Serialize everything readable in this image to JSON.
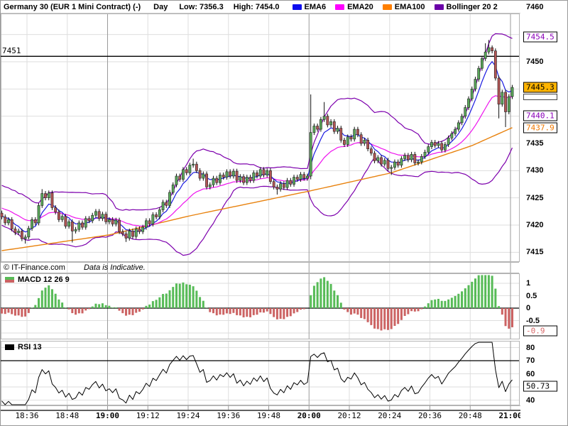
{
  "header": {
    "title": "Germany 30 (EUR 1 Mini Contract) (-)",
    "timeframe": "Day",
    "low_label": "Low: 7356.3",
    "high_label": "High: 7454.0",
    "legend": [
      {
        "name": "EMA6",
        "color": "#0d0dee"
      },
      {
        "name": "EMA20",
        "color": "#ff00ff"
      },
      {
        "name": "EMA100",
        "color": "#ff7f00"
      },
      {
        "name": "Bollinger 20 2",
        "color": "#6a00a8"
      }
    ]
  },
  "watermark": {
    "copyright": "© IT-Finance.com",
    "note": "Data is Indicative."
  },
  "price_axis": {
    "ticks": [
      "7460",
      "7450",
      "7435",
      "7430",
      "7425",
      "7420",
      "7415"
    ],
    "level_line": {
      "price": 7451,
      "label": "7451"
    },
    "boxes": [
      {
        "text": "7454.5",
        "fg": "#8a00b8",
        "bg": "#ffffff",
        "border": "#000000"
      },
      {
        "text": "7445.3",
        "fg": "#000000",
        "bg": "#ffb400",
        "border": "#000000",
        "marker": true
      },
      {
        "text": "7440.1",
        "fg": "#8a00b8",
        "bg": "#ffffff",
        "border": "#000000"
      },
      {
        "text": "7437.9",
        "fg": "#f07800",
        "bg": "#ffffff",
        "border": "#000000"
      }
    ]
  },
  "macd_panel": {
    "label": "MACD 12 26 9",
    "ticks": [
      "1",
      "0.5",
      "0",
      "-0.5"
    ],
    "box": {
      "text": "-0.9",
      "fg": "#d96a6a",
      "bg": "#ffffff",
      "border": "#000000"
    }
  },
  "rsi_panel": {
    "label": "RSI 13",
    "ticks": [
      "80",
      "70",
      "60",
      "40"
    ],
    "box": {
      "text": "50.73",
      "fg": "#000000",
      "bg": "#ffffff",
      "border": "#000000"
    }
  },
  "time_axis": {
    "labels": [
      {
        "text": "18:36",
        "bold": false
      },
      {
        "text": "18:48",
        "bold": false
      },
      {
        "text": "19:00",
        "bold": true
      },
      {
        "text": "19:12",
        "bold": false
      },
      {
        "text": "19:24",
        "bold": false
      },
      {
        "text": "19:36",
        "bold": false
      },
      {
        "text": "19:48",
        "bold": false
      },
      {
        "text": "20:00",
        "bold": true
      },
      {
        "text": "20:12",
        "bold": false
      },
      {
        "text": "20:24",
        "bold": false
      },
      {
        "text": "20:36",
        "bold": false
      },
      {
        "text": "20:48",
        "bold": false
      },
      {
        "text": "21:00",
        "bold": true
      }
    ]
  },
  "chart_data": {
    "type": "candlestick",
    "instrument": "Germany 30 (EUR 1 Mini Contract)",
    "interval": "1-minute",
    "visible_time_range": [
      "18:28",
      "21:00"
    ],
    "price_range_shown": [
      7413,
      7461
    ],
    "day_low": 7356.3,
    "day_high": 7454.0,
    "last_price": 7445.3,
    "level_line_price": 7451,
    "open_first": 7422.2,
    "wick": 0.45,
    "pre_closes": [
      7425.8,
      7426.4,
      7425.2,
      7426.6,
      7425.6,
      7426.2,
      7424.8,
      7425.4,
      7424.0,
      7424.6,
      7423.2,
      7423.8,
      7422.4,
      7423.0,
      7421.8,
      7422.6,
      7421.2,
      7422.0,
      7420.8,
      7421.6
    ],
    "closes": [
      7421.5,
      7420.4,
      7421.0,
      7419.3,
      7418.6,
      7418.9,
      7417.5,
      7417.8,
      7419.4,
      7421.0,
      7420.4,
      7423.6,
      7425.8,
      7425.0,
      7425.9,
      7423.2,
      7422.4,
      7421.0,
      7421.6,
      7419.8,
      7420.6,
      7418.9,
      7419.2,
      7420.4,
      7419.6,
      7421.2,
      7420.8,
      7421.8,
      7422.5,
      7421.2,
      7422.0,
      7420.6,
      7421.0,
      7420.2,
      7420.9,
      7418.8,
      7418.4,
      7417.6,
      7418.9,
      7417.9,
      7419.3,
      7418.8,
      7419.6,
      7420.8,
      7420.2,
      7421.9,
      7421.5,
      7422.8,
      7424.2,
      7423.6,
      7426.0,
      7427.4,
      7429.0,
      7428.4,
      7430.2,
      7429.6,
      7431.0,
      7431.2,
      7430.0,
      7428.6,
      7429.4,
      7427.0,
      7427.4,
      7428.6,
      7427.8,
      7429.2,
      7428.8,
      7429.8,
      7429.0,
      7429.9,
      7428.2,
      7428.9,
      7427.8,
      7428.8,
      7428.2,
      7429.6,
      7429.0,
      7430.2,
      7429.2,
      7430.0,
      7428.0,
      7427.0,
      7426.6,
      7427.6,
      7426.9,
      7428.2,
      7427.5,
      7428.8,
      7428.4,
      7429.3,
      7428.6,
      7429.0,
      7437.0,
      7438.2,
      7437.6,
      7439.4,
      7440.0,
      7438.4,
      7439.0,
      7437.2,
      7437.8,
      7435.6,
      7434.8,
      7436.2,
      7435.8,
      7437.6,
      7436.6,
      7435.0,
      7435.6,
      7434.0,
      7433.2,
      7431.8,
      7432.4,
      7431.2,
      7431.9,
      7430.4,
      7430.6,
      7431.6,
      7431.0,
      7432.2,
      7432.8,
      7432.0,
      7433.0,
      7431.4,
      7431.6,
      7432.6,
      7433.4,
      7434.4,
      7435.2,
      7434.6,
      7435.0,
      7433.8,
      7434.8,
      7436.0,
      7436.8,
      7437.6,
      7438.8,
      7440.0,
      7441.6,
      7443.2,
      7445.0,
      7446.8,
      7448.8,
      7450.6,
      7451.8,
      7452.6,
      7452.0,
      7447.0,
      7442.2,
      7444.4,
      7440.8,
      7443.6,
      7445.3
    ],
    "wick_overrides": {
      "7": {
        "l": 7416.6
      },
      "12": {
        "h": 7426.6
      },
      "21": {
        "l": 7416.8
      },
      "37": {
        "l": 7416.9
      },
      "57": {
        "h": 7432.2
      },
      "82": {
        "l": 7425.6
      },
      "92": {
        "h": 7444.0,
        "l": 7428.4
      },
      "96": {
        "h": 7442.6
      },
      "116": {
        "l": 7429.2
      },
      "144": {
        "h": 7453.4
      },
      "145": {
        "h": 7454.0
      },
      "146": {
        "h": 7453.0
      },
      "148": {
        "l": 7439.6
      },
      "150": {
        "l": 7438.0
      }
    },
    "ema100_path": [
      [
        0,
        7415.3
      ],
      [
        32,
        7418.2
      ],
      [
        56,
        7421.7
      ],
      [
        92,
        7426.3
      ],
      [
        116,
        7429.6
      ],
      [
        140,
        7434.6
      ],
      [
        152,
        7437.9
      ]
    ],
    "indicators": [
      {
        "name": "EMA6",
        "period": 6,
        "color": "#1a1ae0"
      },
      {
        "name": "EMA20",
        "period": 20,
        "color": "#ee14ee"
      },
      {
        "name": "EMA100",
        "period": 100,
        "color": "#e8820e"
      },
      {
        "name": "Bollinger",
        "period": 20,
        "stddev": 2,
        "color": "#7d00ad"
      },
      {
        "name": "MACD",
        "fast": 12,
        "slow": 26,
        "signal": 9,
        "up_color": "#57bb57",
        "down_color": "#cc6363",
        "axis_range": [
          -1.3,
          1.35
        ],
        "last_histogram": -0.9
      },
      {
        "name": "RSI",
        "period": 13,
        "color": "#000000",
        "axis_range": [
          36,
          85
        ],
        "last": 50.73
      }
    ],
    "candle_up_color": "#5aa85a",
    "candle_down_color": "#b25555"
  }
}
